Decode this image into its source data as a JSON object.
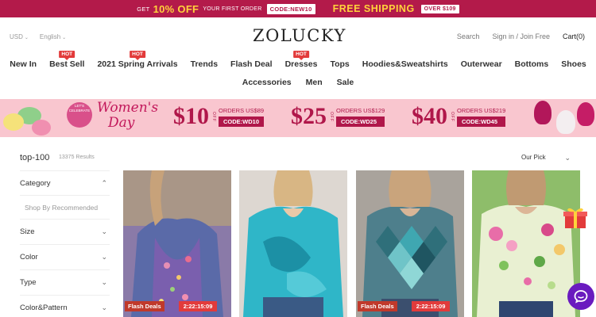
{
  "promo": {
    "get": "GET",
    "discount": "10% OFF",
    "first_order": "YOUR FIRST ORDER",
    "code": "CODE:NEW10",
    "free_shipping": "FREE SHIPPING",
    "over": "OVER $109"
  },
  "header": {
    "currency": "USD",
    "language": "English",
    "logo": "ZOLUCKY",
    "search": "Search",
    "signin": "Sign in / Join Free",
    "cart": "Cart(0)"
  },
  "nav": {
    "row1": [
      {
        "label": "New In",
        "hot": false
      },
      {
        "label": "Best Sell",
        "hot": true
      },
      {
        "label": "2021 Spring Arrivals",
        "hot": true
      },
      {
        "label": "Trends",
        "hot": false
      },
      {
        "label": "Flash Deal",
        "hot": false
      },
      {
        "label": "Dresses",
        "hot": true
      },
      {
        "label": "Tops",
        "hot": false
      },
      {
        "label": "Hoodies&Sweatshirts",
        "hot": false
      },
      {
        "label": "Outerwear",
        "hot": false
      },
      {
        "label": "Bottoms",
        "hot": false
      },
      {
        "label": "Shoes",
        "hot": false
      }
    ],
    "row2": [
      {
        "label": "Accessories"
      },
      {
        "label": "Men"
      },
      {
        "label": "Sale"
      }
    ],
    "hot_label": "HOT"
  },
  "banner": {
    "lets": "LET'S CELEBRATE",
    "title_line1": "Women's",
    "title_line2": "Day",
    "off_label": "OFF",
    "deals": [
      {
        "amount": "$10",
        "orders": "ORDERS US$89",
        "code": "CODE:WD10"
      },
      {
        "amount": "$25",
        "orders": "ORDERS US$129",
        "code": "CODE:WD25"
      },
      {
        "amount": "$40",
        "orders": "ORDERS US$219",
        "code": "CODE:WD45"
      }
    ]
  },
  "results": {
    "title": "top-100",
    "count": "13375 Results",
    "sort": "Our Pick"
  },
  "filters": {
    "category": "Category",
    "category_sub": "Shop By Recommended",
    "items": [
      "Size",
      "Color",
      "Type",
      "Color&Pattern"
    ]
  },
  "products": [
    {
      "flash": "Flash Deals",
      "timer": "2:22:15:09",
      "has_flash": true
    },
    {
      "flash": "",
      "timer": "",
      "has_flash": false
    },
    {
      "flash": "Flash Deals",
      "timer": "2:22:15:09",
      "has_flash": true
    },
    {
      "flash": "",
      "timer": "",
      "has_flash": false
    }
  ],
  "colors": {
    "brand": "#b31a4a",
    "promo_yellow": "#ffd23b",
    "hot": "#e23b3b",
    "banner_bg": "#f9c6cf",
    "chat": "#6a1bbf"
  }
}
